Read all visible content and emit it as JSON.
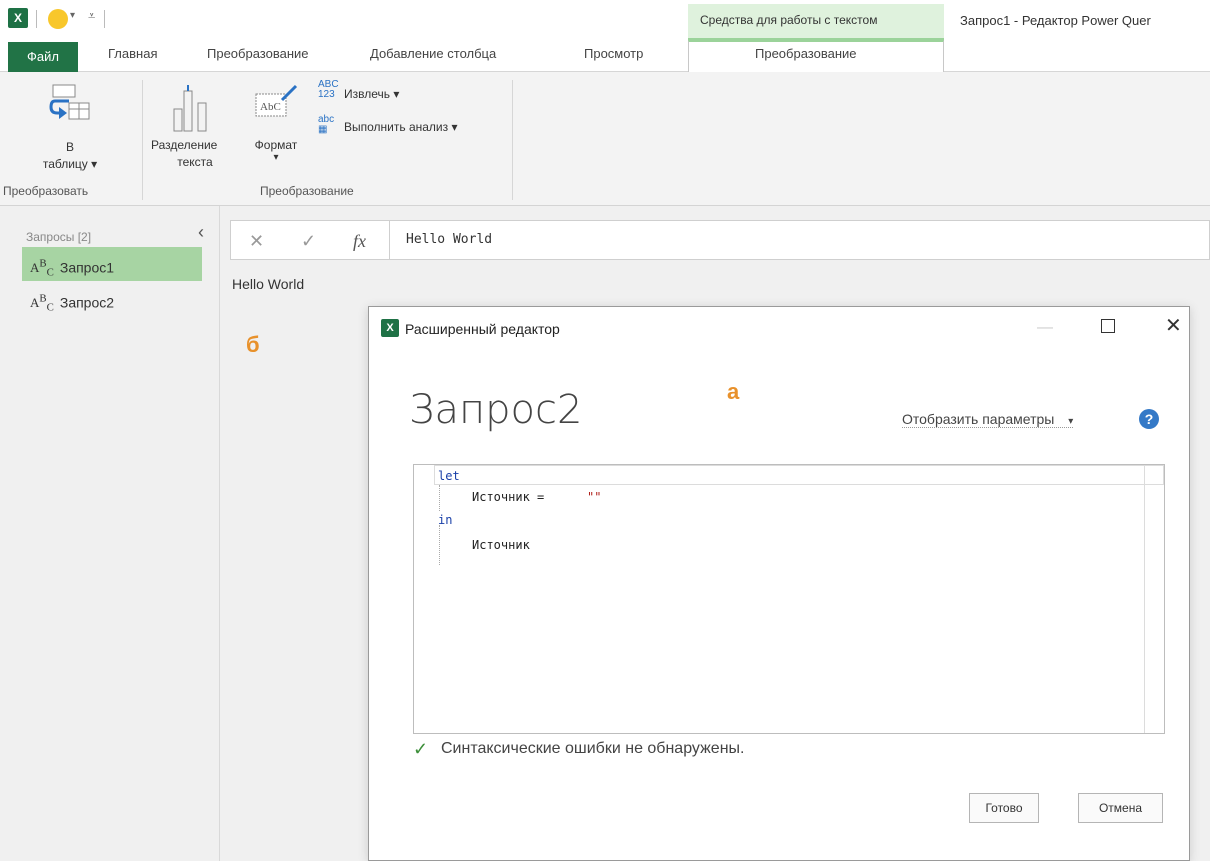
{
  "app": {
    "context_group": "Средства для работы с текстом",
    "window_title": "Запрос1 - Редактор Power Quer"
  },
  "tabs": {
    "file": "Файл",
    "items": [
      "Главная",
      "Преобразование",
      "Добавление столбца",
      "Просмотр"
    ],
    "context": "Преобразование"
  },
  "ribbon": {
    "to_table_line1": "В",
    "to_table_line2": "таблицу ▾",
    "group1_label": "Преобразовать",
    "split_line1": "Разделение",
    "split_line2": "текста",
    "format_line1": "Формат",
    "format_line2": "▾",
    "extract": "Извлечь ▾",
    "parse": "Выполнить анализ ▾",
    "group2_label": "Преобразование"
  },
  "queries": {
    "header": "Запросы [2]",
    "items": [
      "Запрос1",
      "Запрос2"
    ]
  },
  "formula": {
    "text": "Hello World"
  },
  "preview": {
    "value": "Hello World"
  },
  "annotations": {
    "b": "б",
    "a": "а"
  },
  "dialog": {
    "title": "Расширенный редактор",
    "query_name": "Запрос2",
    "options_label": "Отобразить параметры",
    "options_arrow": "▾",
    "code": {
      "line1": "let",
      "line2a": "Источник = ",
      "line2b": "\"\"",
      "line3": "in",
      "line4": "Источник"
    },
    "status": "Синтаксические ошибки не обнаружены.",
    "ok": "Готово",
    "cancel": "Отмена"
  }
}
